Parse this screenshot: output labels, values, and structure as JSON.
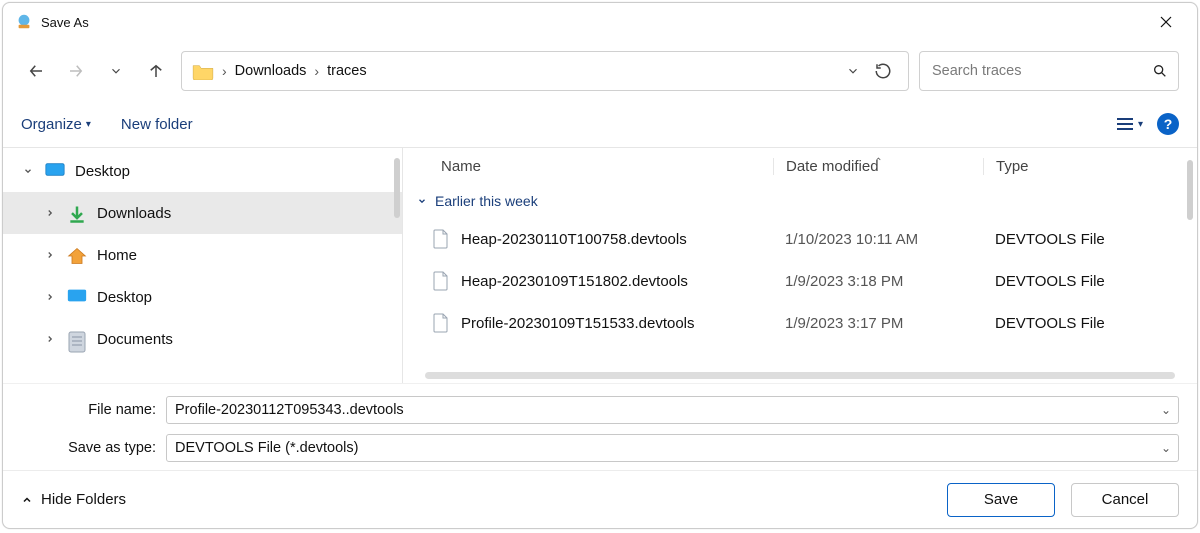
{
  "title": "Save As",
  "breadcrumb": [
    "Downloads",
    "traces"
  ],
  "search_placeholder": "Search traces",
  "toolbar": {
    "organize": "Organize",
    "new_folder": "New folder"
  },
  "tree": {
    "desktop": "Desktop",
    "downloads": "Downloads",
    "home": "Home",
    "desktop2": "Desktop",
    "documents": "Documents"
  },
  "columns": {
    "name": "Name",
    "date": "Date modified",
    "type": "Type"
  },
  "group_label": "Earlier this week",
  "files": [
    {
      "name": "Heap-20230110T100758.devtools",
      "date": "1/10/2023 10:11 AM",
      "type": "DEVTOOLS File"
    },
    {
      "name": "Heap-20230109T151802.devtools",
      "date": "1/9/2023 3:18 PM",
      "type": "DEVTOOLS File"
    },
    {
      "name": "Profile-20230109T151533.devtools",
      "date": "1/9/2023 3:17 PM",
      "type": "DEVTOOLS File"
    }
  ],
  "form": {
    "file_name_label": "File name:",
    "save_type_label": "Save as type:",
    "file_name_value": "Profile-20230112T095343..devtools",
    "save_type_value": "DEVTOOLS File (*.devtools)"
  },
  "footer": {
    "hide_folders": "Hide Folders",
    "save": "Save",
    "cancel": "Cancel"
  }
}
